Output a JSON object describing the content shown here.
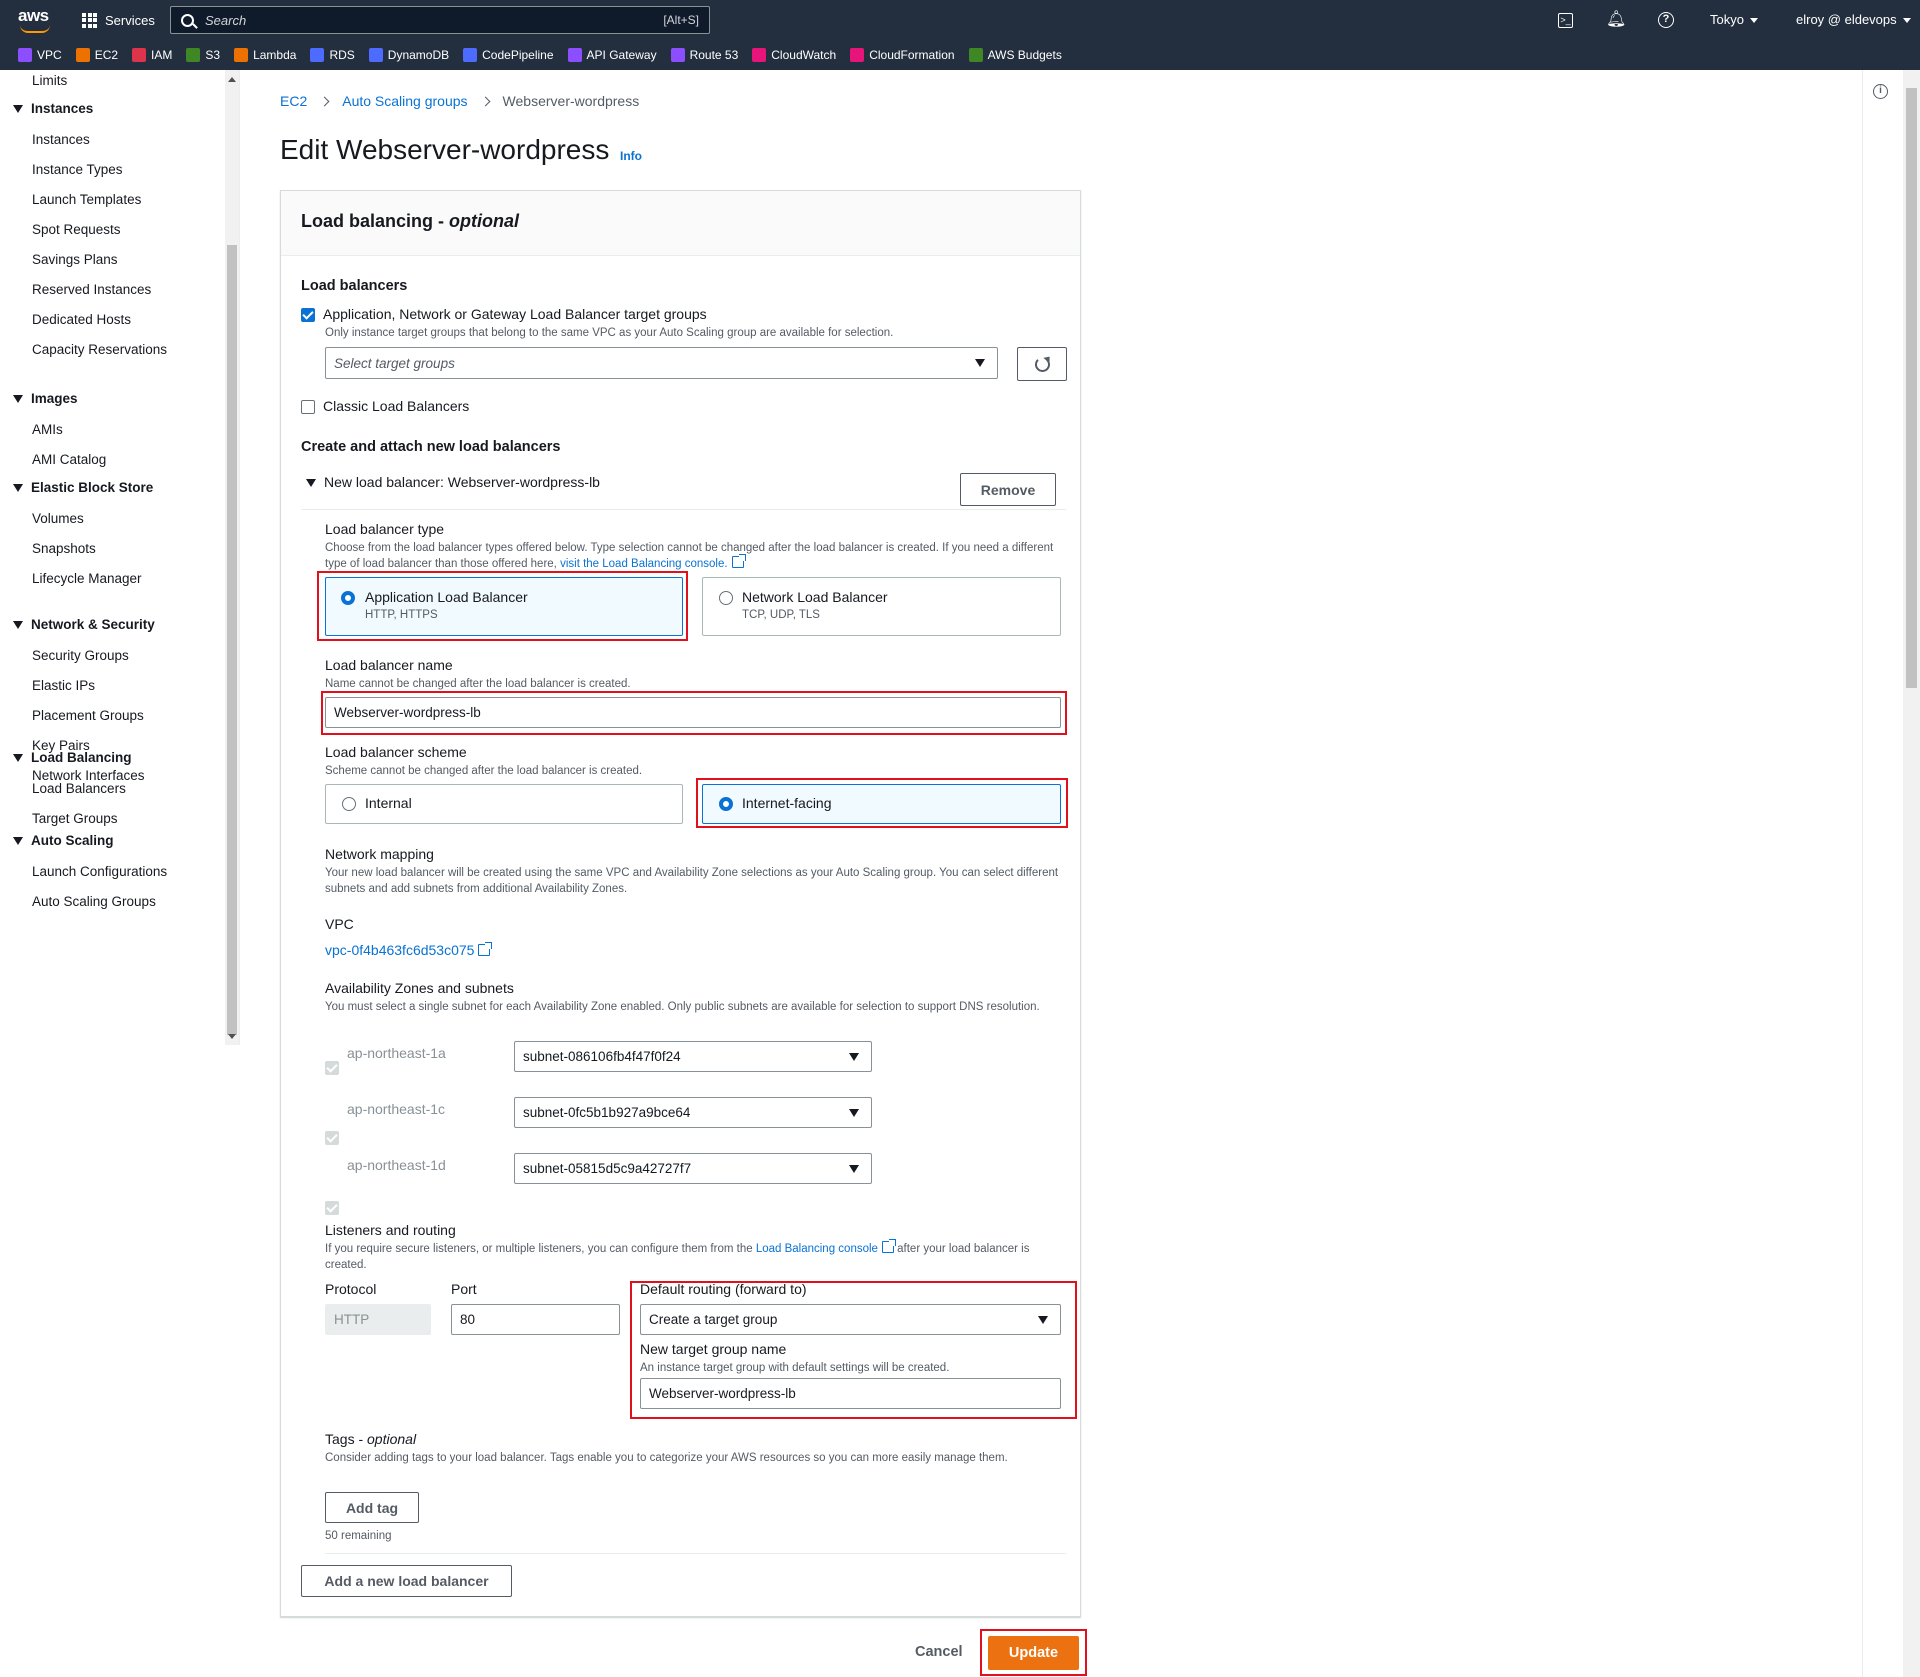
{
  "topbar": {
    "services_label": "Services",
    "search_placeholder": "Search",
    "search_shortcut": "[Alt+S]",
    "region": "Tokyo",
    "user": "elroy @ eldevops",
    "logo_text": "aws"
  },
  "favorites": [
    {
      "label": "VPC",
      "color": "#8c4fff"
    },
    {
      "label": "EC2",
      "color": "#ed7100"
    },
    {
      "label": "IAM",
      "color": "#dd344c"
    },
    {
      "label": "S3",
      "color": "#3f8624"
    },
    {
      "label": "Lambda",
      "color": "#ed7100"
    },
    {
      "label": "RDS",
      "color": "#4d6bfe"
    },
    {
      "label": "DynamoDB",
      "color": "#4d6bfe"
    },
    {
      "label": "CodePipeline",
      "color": "#4d6bfe"
    },
    {
      "label": "API Gateway",
      "color": "#8c4fff"
    },
    {
      "label": "Route 53",
      "color": "#8c4fff"
    },
    {
      "label": "CloudWatch",
      "color": "#e7157b"
    },
    {
      "label": "CloudFormation",
      "color": "#e7157b"
    },
    {
      "label": "AWS Budgets",
      "color": "#3f8624"
    }
  ],
  "sidebar": {
    "top_item": "Limits",
    "sections": [
      {
        "title": "Instances",
        "items": [
          "Instances",
          "Instance Types",
          "Launch Templates",
          "Spot Requests",
          "Savings Plans",
          "Reserved Instances",
          "Dedicated Hosts",
          "Capacity Reservations"
        ]
      },
      {
        "title": "Images",
        "items": [
          "AMIs",
          "AMI Catalog"
        ]
      },
      {
        "title": "Elastic Block Store",
        "items": [
          "Volumes",
          "Snapshots",
          "Lifecycle Manager"
        ]
      },
      {
        "title": "Network & Security",
        "items": [
          "Security Groups",
          "Elastic IPs",
          "Placement Groups",
          "Key Pairs",
          "Network Interfaces"
        ]
      },
      {
        "title": "Load Balancing",
        "items": [
          "Load Balancers",
          "Target Groups"
        ]
      },
      {
        "title": "Auto Scaling",
        "items": [
          "Launch Configurations",
          "Auto Scaling Groups"
        ]
      }
    ]
  },
  "breadcrumb": {
    "items": [
      "EC2",
      "Auto Scaling groups"
    ],
    "current": "Webserver-wordpress"
  },
  "page": {
    "title": "Edit Webserver-wordpress",
    "info": "Info"
  },
  "panel": {
    "title": "Load balancing - ",
    "title_optional": "optional",
    "load_balancers_heading": "Load balancers",
    "target_groups_checkbox": "Application, Network or Gateway Load Balancer target groups",
    "target_groups_desc": "Only instance target groups that belong to the same VPC as your Auto Scaling group are available for selection.",
    "target_groups_placeholder": "Select target groups",
    "classic_checkbox": "Classic Load Balancers",
    "create_heading": "Create and attach new load balancers",
    "new_lb_label": "New load balancer: Webserver-wordpress-lb",
    "remove_button": "Remove",
    "lb_type": {
      "label": "Load balancer type",
      "desc": "Choose from the load balancer types offered below. Type selection cannot be changed after the load balancer is created. If you need a different type of load balancer than those offered here, ",
      "desc_link": "visit the Load Balancing console.",
      "alb_title": "Application Load Balancer",
      "alb_sub": "HTTP, HTTPS",
      "nlb_title": "Network Load Balancer",
      "nlb_sub": "TCP, UDP, TLS"
    },
    "lb_name": {
      "label": "Load balancer name",
      "desc": "Name cannot be changed after the load balancer is created.",
      "value": "Webserver-wordpress-lb"
    },
    "lb_scheme": {
      "label": "Load balancer scheme",
      "desc": "Scheme cannot be changed after the load balancer is created.",
      "internal": "Internal",
      "internet": "Internet-facing"
    },
    "network_mapping": {
      "label": "Network mapping",
      "desc": "Your new load balancer will be created using the same VPC and Availability Zone selections as your Auto Scaling group. You can select different subnets and add subnets from additional Availability Zones.",
      "vpc_label": "VPC",
      "vpc_value": "vpc-0f4b463fc6d53c075",
      "az_label": "Availability Zones and subnets",
      "az_desc": "You must select a single subnet for each Availability Zone enabled. Only public subnets are available for selection to support DNS resolution.",
      "zones": [
        {
          "az": "ap-northeast-1a",
          "subnet": "subnet-086106fb4f47f0f24"
        },
        {
          "az": "ap-northeast-1c",
          "subnet": "subnet-0fc5b1b927a9bce64"
        },
        {
          "az": "ap-northeast-1d",
          "subnet": "subnet-05815d5c9a42727f7"
        }
      ]
    },
    "listeners": {
      "label": "Listeners and routing",
      "desc_pre": "If you require secure listeners, or multiple listeners, you can configure them from the ",
      "desc_link": "Load Balancing console",
      "desc_post": " after your load balancer is created.",
      "protocol_label": "Protocol",
      "protocol_value": "HTTP",
      "port_label": "Port",
      "port_value": "80",
      "routing_label": "Default routing (forward to)",
      "routing_value": "Create a target group",
      "tg_name_label": "New target group name",
      "tg_name_desc": "An instance target group with default settings will be created.",
      "tg_name_value": "Webserver-wordpress-lb"
    },
    "tags": {
      "label": "Tags - ",
      "label_optional": "optional",
      "desc": "Consider adding tags to your load balancer. Tags enable you to categorize your AWS resources so you can more easily manage them.",
      "add_button": "Add tag",
      "remaining": "50 remaining"
    },
    "add_new_lb_button": "Add a new load balancer"
  },
  "footer": {
    "cancel": "Cancel",
    "update": "Update"
  }
}
